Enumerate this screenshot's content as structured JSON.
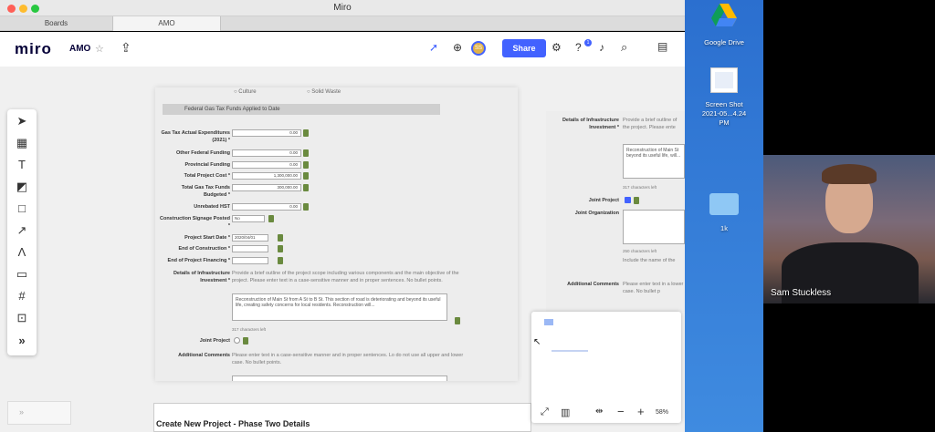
{
  "window": {
    "title": "Miro",
    "tabs": [
      "Boards",
      "AMO"
    ]
  },
  "topbar": {
    "logo": "miro",
    "board_name": "AMO",
    "share_label": "Share",
    "avatar_initials": "SS",
    "notification_count": "1"
  },
  "canvas": {
    "form": {
      "radio_options": [
        "Culture",
        "Solid Waste"
      ],
      "section_header": "Federal Gas Tax Funds Applied to Date",
      "fields": [
        {
          "label": "Gas Tax Actual Expenditures (2021) *",
          "value": "0.00"
        },
        {
          "label": "Other Federal Funding",
          "value": "0.00"
        },
        {
          "label": "Provincial Funding",
          "value": "0.00"
        },
        {
          "label": "Total Project Cost *",
          "value": "1,300,000.00"
        },
        {
          "label": "Total Gas Tax Funds Budgeted *",
          "value": "300,000.00"
        },
        {
          "label": "Unrebated HST",
          "value": "0.00"
        }
      ],
      "signage_label": "Construction Signage Posted *",
      "signage_value": "No",
      "start_label": "Project Start Date *",
      "start_value": "2020/04/01",
      "end_label": "End of Construction *",
      "financing_label": "End of Project Financing *",
      "details_label": "Details of Infrastructure Investment *",
      "details_desc": "Provide a brief outline of the project scope including various components and the main objective of the project. Please enter text in a case-sensitive manner and in proper sentences. No bullet points.",
      "details_text": "Reconstruction of Main St from A St to B St. This section of road is deteriorating and beyond its useful life, creating safety concerns for local residents. Reconstruction will...",
      "char_count": "317 characters left",
      "joint_label": "Joint Project",
      "comments_label": "Additional Comments",
      "comments_desc": "Please enter text in a case-sensitive manner and in proper sentences. Lo do not use all upper and lower case. No bullet points."
    },
    "right_panel": {
      "details_label": "Details of Infrastructure Investment *",
      "desc": "Provide a brief outline of the project. Please ente",
      "text": "Reconstruction of Main St beyond its useful life, will...",
      "char_count": "317 characters left",
      "joint_label": "Joint Project",
      "org_label": "Joint Organization",
      "org_count": "250 characters left",
      "org_hint": "Include the name of the",
      "comments_label": "Additional Comments",
      "comments_desc": "Please enter text in a lower case. No bullet p"
    },
    "bottom_title": "Create  New Project - Phase Two Details",
    "zoom": "58%"
  },
  "desktop": {
    "items": [
      {
        "label": "Google Drive"
      },
      {
        "label": "Screen Shot 2021-05...4.24 PM"
      },
      {
        "label": "1k"
      }
    ]
  },
  "webcam": {
    "name": "Sam Stuckless"
  },
  "colors": {
    "accent": "#4262ff",
    "desktop_bg": "#3a7fd8",
    "green_btn": "#6a8a3f"
  }
}
